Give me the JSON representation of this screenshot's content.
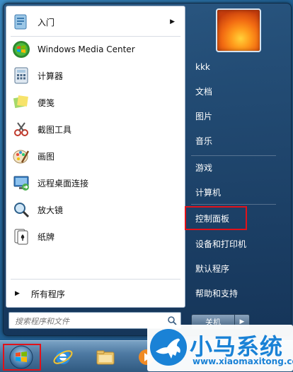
{
  "start_menu": {
    "programs": [
      {
        "label": "入门",
        "icon": "getting-started-icon",
        "has_submenu": true
      },
      {
        "label": "Windows Media Center",
        "icon": "media-center-icon",
        "has_submenu": false
      },
      {
        "label": "计算器",
        "icon": "calculator-icon",
        "has_submenu": false
      },
      {
        "label": "便笺",
        "icon": "sticky-notes-icon",
        "has_submenu": false
      },
      {
        "label": "截图工具",
        "icon": "snipping-tool-icon",
        "has_submenu": false
      },
      {
        "label": "画图",
        "icon": "paint-icon",
        "has_submenu": false
      },
      {
        "label": "远程桌面连接",
        "icon": "remote-desktop-icon",
        "has_submenu": false
      },
      {
        "label": "放大镜",
        "icon": "magnifier-icon",
        "has_submenu": false
      },
      {
        "label": "纸牌",
        "icon": "solitaire-icon",
        "has_submenu": false
      }
    ],
    "all_programs": "所有程序",
    "search_placeholder": "搜索程序和文件",
    "right_items": [
      {
        "label": "kkk"
      },
      {
        "label": "文档"
      },
      {
        "label": "图片"
      },
      {
        "label": "音乐"
      },
      {
        "label": "游戏"
      },
      {
        "label": "计算机"
      },
      {
        "label": "控制面板"
      },
      {
        "label": "设备和打印机"
      },
      {
        "label": "默认程序"
      },
      {
        "label": "帮助和支持"
      }
    ],
    "shutdown_label": "关机"
  },
  "highlight_color": "#e1121a",
  "watermark": {
    "title": "小马系统",
    "url": "www.xiaomaxitong.com"
  }
}
